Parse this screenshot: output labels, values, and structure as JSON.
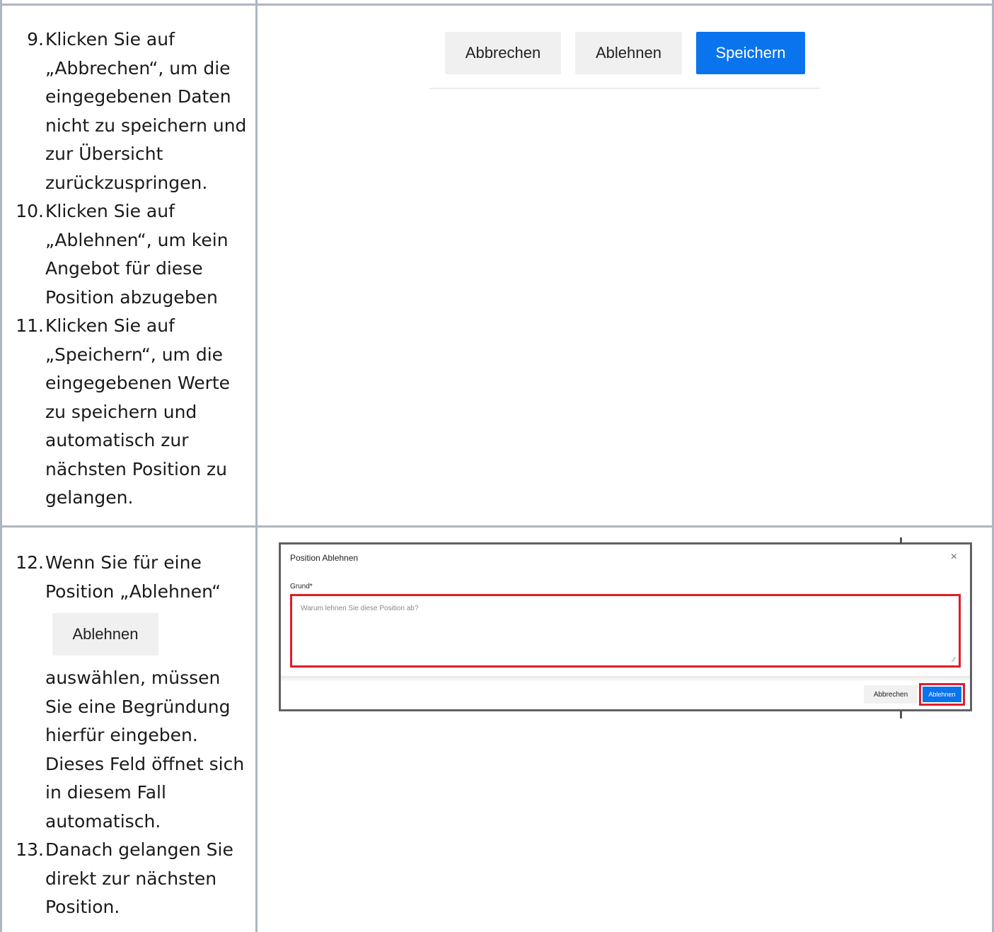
{
  "row1": {
    "steps": [
      {
        "num": "9.",
        "text": "Klicken Sie auf „Abbrechen“, um die eingegebenen Daten nicht zu speichern und zur Übersicht zurückzuspringen."
      },
      {
        "num": "10.",
        "text": "Klicken Sie auf „Ablehnen“, um kein Angebot für diese Position abzugeben"
      },
      {
        "num": "11.",
        "text": "Klicken Sie auf „Speichern“, um die eingegebenen Werte zu speichern und automatisch zur nächsten Position zu gelangen."
      }
    ],
    "buttons": {
      "cancel": "Abbrechen",
      "reject": "Ablehnen",
      "save": "Speichern"
    }
  },
  "row2": {
    "step12_text_a": "Wenn Sie für eine Position „Ablehnen“",
    "step12_button": "Ablehnen",
    "step12_text_b": "auswählen, müssen Sie eine Begründung hierfür eingeben. Dieses Feld öffnet sich in diesem Fall automatisch.",
    "step12_num": "12.",
    "step13_num": "13.",
    "step13_text": "Danach gelangen Sie direkt zur nächsten Position.",
    "dialog": {
      "title": "Position Ablehnen",
      "close": "×",
      "field_label": "Grund*",
      "placeholder": "Warum lehnen Sie diese Position ab?",
      "cancel": "Abbrechen",
      "reject": "Ablehnen"
    }
  },
  "colors": {
    "border": "#aeb6c1",
    "primary": "#0a74ef",
    "highlight": "#e11d2a"
  }
}
